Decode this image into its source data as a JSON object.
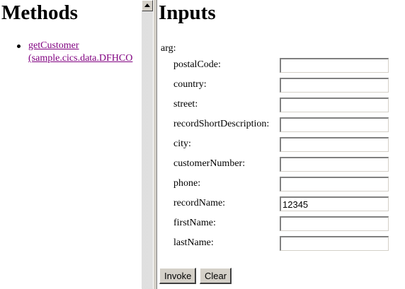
{
  "methods_panel": {
    "title": "Methods",
    "items": [
      {
        "label_line1": "getCustomer",
        "label_line2": "(sample.cics.data.DFHCO"
      }
    ]
  },
  "inputs_panel": {
    "title": "Inputs",
    "arg_label": "arg:",
    "fields": [
      {
        "label": "postalCode:",
        "value": ""
      },
      {
        "label": "country:",
        "value": ""
      },
      {
        "label": "street:",
        "value": ""
      },
      {
        "label": "recordShortDescription:",
        "value": ""
      },
      {
        "label": "city:",
        "value": ""
      },
      {
        "label": "customerNumber:",
        "value": ""
      },
      {
        "label": "phone:",
        "value": ""
      },
      {
        "label": "recordName:",
        "value": "12345"
      },
      {
        "label": "firstName:",
        "value": ""
      },
      {
        "label": "lastName:",
        "value": ""
      }
    ],
    "invoke_label": "Invoke",
    "clear_label": "Clear"
  }
}
